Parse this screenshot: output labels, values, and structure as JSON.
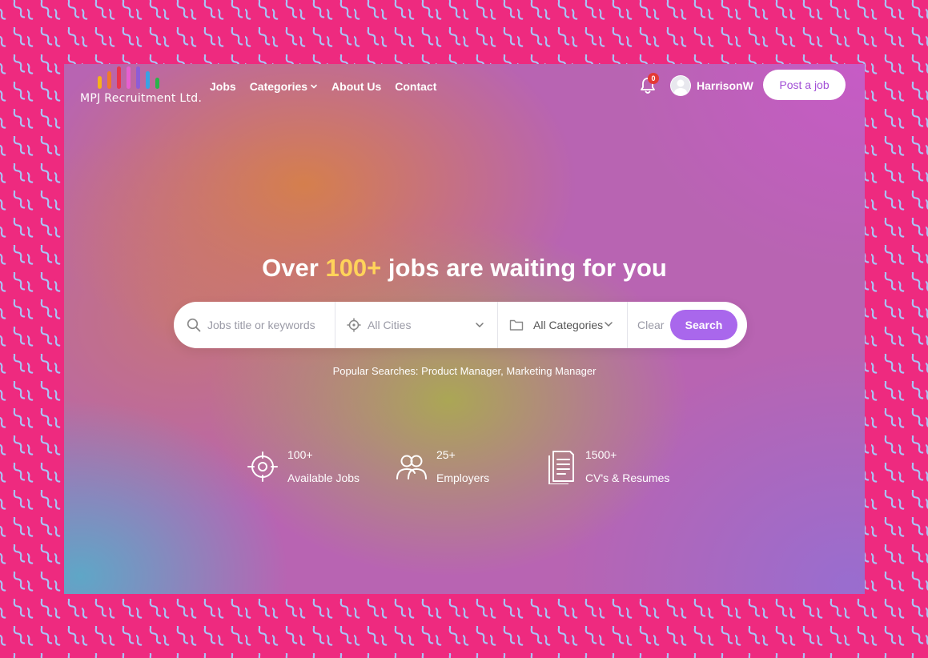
{
  "brand": {
    "name": "MPJ Recruitment Ltd.",
    "bar_colors": [
      "#f6b21a",
      "#f07a2b",
      "#e8344c",
      "#e75fd0",
      "#8e5cd6",
      "#3aa2e4",
      "#2bb34a"
    ]
  },
  "nav": {
    "items": [
      {
        "label": "Jobs"
      },
      {
        "label": "Categories",
        "has_dropdown": true
      },
      {
        "label": "About Us"
      },
      {
        "label": "Contact"
      }
    ]
  },
  "notifications": {
    "count": "0",
    "icon": "bell-icon"
  },
  "user": {
    "name": "HarrisonW",
    "icon": "avatar"
  },
  "post_job": {
    "label": "Post a job"
  },
  "hero": {
    "headline_prefix": "Over",
    "headline_accent": "100+",
    "headline_suffix": "jobs are waiting for you"
  },
  "search": {
    "keyword_placeholder": "Jobs title or keywords",
    "city_value": "All Cities",
    "category_value": "All Categories",
    "clear_label": "Clear",
    "submit_label": "Search"
  },
  "popular": {
    "label": "Popular Searches:",
    "items": [
      "Product Manager,",
      "Marketing Manager"
    ]
  },
  "stats": [
    {
      "value": "100+",
      "label": "Available Jobs",
      "icon": "crosshair-icon"
    },
    {
      "value": "25+",
      "label": "Employers",
      "icon": "users-icon"
    },
    {
      "value": "1500+",
      "label": "CV's & Resumes",
      "icon": "document-icon"
    }
  ],
  "colors": {
    "frame": "#ee2a7f",
    "squiggle": "#a9c4f5",
    "accent_text": "#ffd35a",
    "search_button": "#a967ec",
    "post_button_text": "#a24fd6",
    "badge": "#e53935"
  }
}
